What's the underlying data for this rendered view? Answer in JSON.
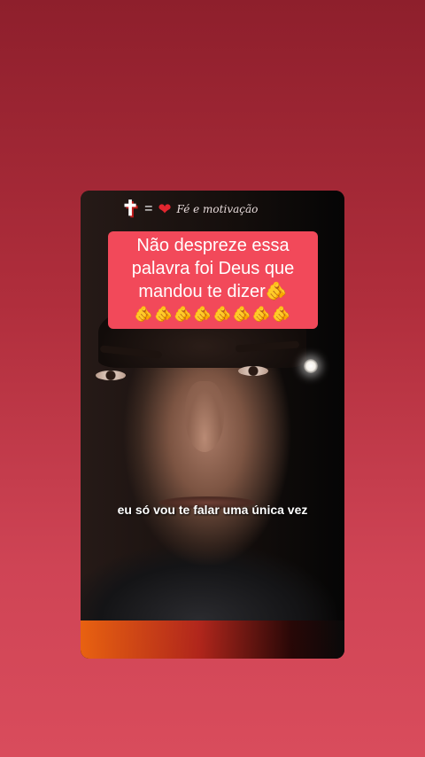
{
  "header": {
    "cross_icon": "cross-icon",
    "equals": "=",
    "heart_icon": "heart-icon",
    "brand": "Fé e motivação"
  },
  "caption": {
    "text": "Não despreze essa palavra foi Deus que mandou te dizer🫵",
    "emojis": "🫵🫵🫵🫵🫵🫵🫵🫵"
  },
  "video": {
    "subtitle": "eu só vou te falar uma única vez"
  },
  "colors": {
    "background_top": "#8e1f2c",
    "background_bottom": "#d94c5c",
    "caption_box": "#f2495a"
  }
}
